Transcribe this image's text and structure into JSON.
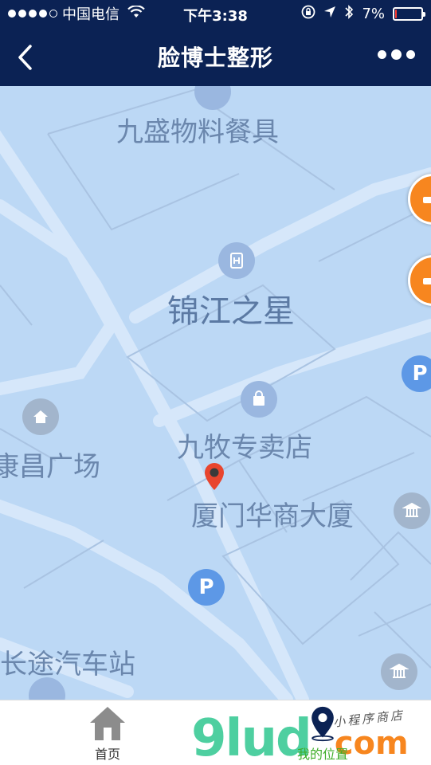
{
  "status_bar": {
    "carrier": "中国电信",
    "time": "下午3:38",
    "battery_percent": "7%",
    "battery_level": 0.07,
    "battery_color": "#ff3b30"
  },
  "nav": {
    "title": "脸博士整形",
    "back_icon": "chevron-left-icon",
    "more_icon": "more-dots-icon"
  },
  "map": {
    "labels": {
      "jiusheng": "九盛物料餐具",
      "jinjiang": "锦江之星",
      "jiumu": "九牧专卖店",
      "kangchang": "康昌广场",
      "huashang": "厦门华商大厦",
      "changtu": "长途汽车站"
    },
    "poi": {
      "parking_glyph": "P"
    },
    "pin_color": "#e8452e",
    "button_color": "#f7861f"
  },
  "tabbar": {
    "home_label": "首页",
    "location_label": "我的位置",
    "active_color": "#3fae2a"
  },
  "watermark": {
    "text_main": "9lud",
    "text_domain": "com",
    "slogan": "小程序商店"
  }
}
